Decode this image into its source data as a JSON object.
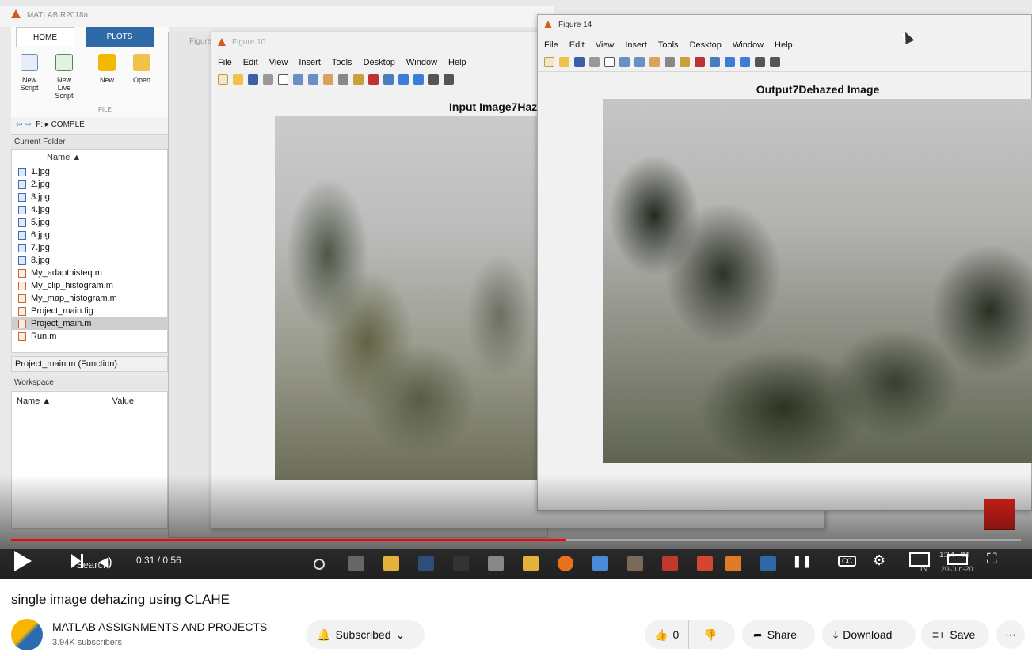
{
  "matlab": {
    "window_title": "MATLAB R2018a",
    "ribbon_tabs": [
      "HOME",
      "PLOTS"
    ],
    "ribbon_buttons": [
      {
        "label": "New\nScript",
        "icon": "new-script-icon"
      },
      {
        "label": "New\nLive Script",
        "icon": "new-live-script-icon"
      },
      {
        "label": "New",
        "icon": "new-plus-icon"
      },
      {
        "label": "Open",
        "icon": "open-folder-icon"
      }
    ],
    "ribbon_section": "FILE",
    "address": "F: ▸ COMPLE",
    "current_folder_label": "Current Folder",
    "files_column": "Name ▲",
    "files": [
      {
        "name": "1.jpg",
        "type": "image"
      },
      {
        "name": "2.jpg",
        "type": "image"
      },
      {
        "name": "3.jpg",
        "type": "image"
      },
      {
        "name": "4.jpg",
        "type": "image"
      },
      {
        "name": "5.jpg",
        "type": "image"
      },
      {
        "name": "6.jpg",
        "type": "image"
      },
      {
        "name": "7.jpg",
        "type": "image"
      },
      {
        "name": "8.jpg",
        "type": "image"
      },
      {
        "name": "My_adapthisteq.m",
        "type": "mfile"
      },
      {
        "name": "My_clip_histogram.m",
        "type": "mfile"
      },
      {
        "name": "My_map_histogram.m",
        "type": "mfile"
      },
      {
        "name": "Project_main.fig",
        "type": "fig"
      },
      {
        "name": "Project_main.m",
        "type": "mfile",
        "selected": true
      },
      {
        "name": "Run.m",
        "type": "mfile"
      }
    ],
    "function_bar": "Project_main.m  (Function)",
    "workspace_label": "Workspace",
    "workspace_columns": [
      "Name ▲",
      "Value"
    ]
  },
  "figure_back": {
    "title": "Figure"
  },
  "figure_input": {
    "title": "Figure 10",
    "menu": [
      "File",
      "Edit",
      "View",
      "Insert",
      "Tools",
      "Desktop",
      "Window",
      "Help"
    ],
    "axes_title": "Input Image7Haz"
  },
  "figure_output": {
    "title": "Figure 14",
    "menu": [
      "File",
      "Edit",
      "View",
      "Insert",
      "Tools",
      "Desktop",
      "Window",
      "Help"
    ],
    "axes_title": "Output7Dehazed Image"
  },
  "player": {
    "time": "0:31 / 0:56",
    "progress": 0.55,
    "search_text": "Search",
    "taskbar_clock": "1:14 PM",
    "taskbar_date": "20-Jun-20",
    "taskbar_lang": "IN"
  },
  "video": {
    "title": "single image dehazing using CLAHE",
    "channel": "MATLAB ASSIGNMENTS AND PROJECTS",
    "subscribers": "3.94K subscribers",
    "subscribe_label": "Subscribed",
    "likes": "0",
    "share_label": "Share",
    "download_label": "Download",
    "save_label": "Save"
  },
  "colors": {
    "progress": "#ff0000",
    "matlab_accent": "#d9591b",
    "ribbon_tab_active": "#2e6aa8"
  }
}
